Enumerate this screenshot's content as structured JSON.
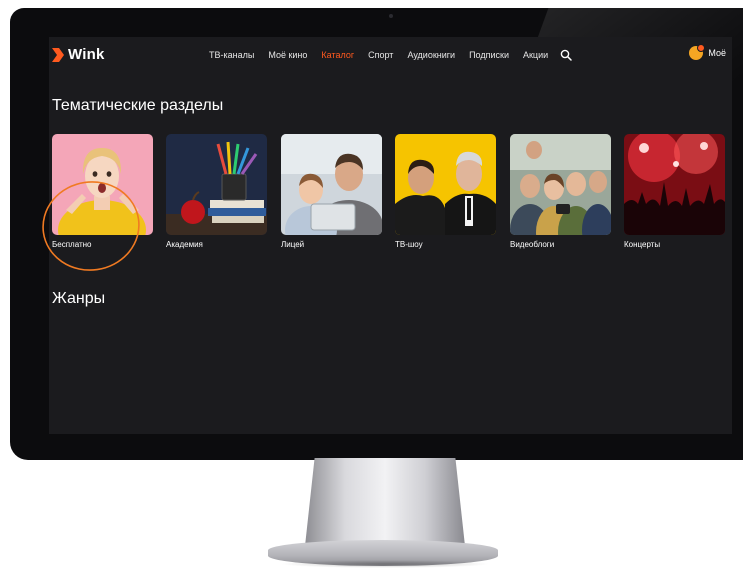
{
  "app": {
    "logo_text": "Wink"
  },
  "nav": {
    "items": [
      {
        "label": "ТВ-каналы",
        "active": false
      },
      {
        "label": "Моё кино",
        "active": false
      },
      {
        "label": "Каталог",
        "active": true
      },
      {
        "label": "Спорт",
        "active": false
      },
      {
        "label": "Аудиокниги",
        "active": false
      },
      {
        "label": "Подписки",
        "active": false
      },
      {
        "label": "Акции",
        "active": false
      }
    ],
    "search_icon": "search-icon"
  },
  "profile": {
    "label": "Моё",
    "avatar_color": "#f5a623"
  },
  "thematic": {
    "title": "Тематические разделы",
    "cards": [
      {
        "label": "Бесплатно",
        "image": "surprised-woman-yellow-sweater"
      },
      {
        "label": "Академия",
        "image": "pencils-books-apple"
      },
      {
        "label": "Лицей",
        "image": "father-child-tablet"
      },
      {
        "label": "ТВ-шоу",
        "image": "two-hosts-yellow-background"
      },
      {
        "label": "Видеоблоги",
        "image": "friends-selfie-phone"
      },
      {
        "label": "Концерты",
        "image": "concert-crowd-red-lights"
      }
    ]
  },
  "genres": {
    "title": "Жанры"
  },
  "colors": {
    "accent": "#ff5a1f",
    "screen_bg": "#1b1b1e",
    "annotation": "#f07a22"
  }
}
